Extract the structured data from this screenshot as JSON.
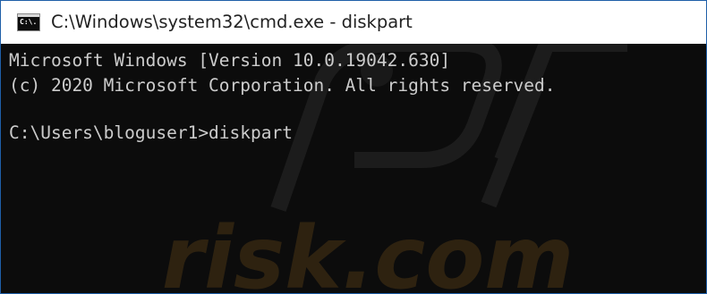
{
  "window": {
    "title": "C:\\Windows\\system32\\cmd.exe - diskpart",
    "icon_label": "C:\\."
  },
  "console": {
    "line1": "Microsoft Windows [Version 10.0.19042.630]",
    "line2": "(c) 2020 Microsoft Corporation. All rights reserved.",
    "line3": "C:\\Users\\bloguser1>diskpart"
  },
  "watermark": {
    "text": "risk.com"
  },
  "colors": {
    "console_background": "#0c0c0c",
    "console_text": "#cccccc",
    "titlebar_background": "#ffffff",
    "window_border": "#1f5fa8",
    "watermark": "#3a2a12"
  }
}
